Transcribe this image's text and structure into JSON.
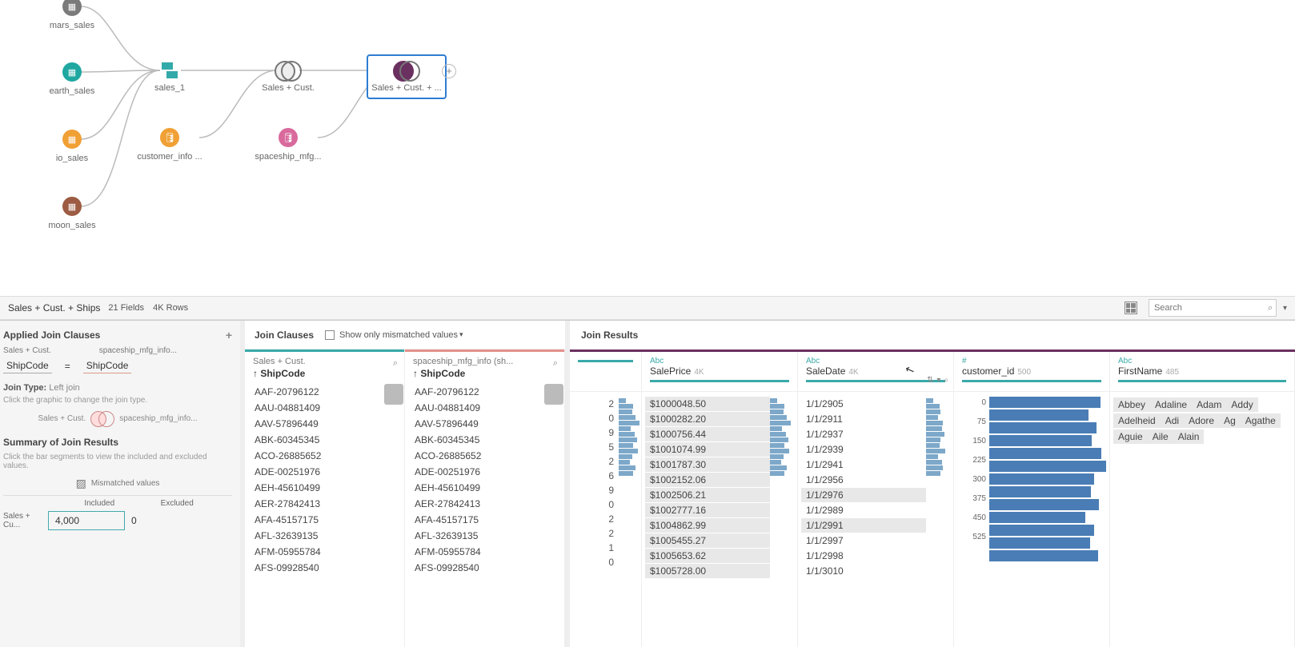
{
  "flow": {
    "nodes": {
      "mars_sales": {
        "label": "mars_sales",
        "color": "#7a7a7a"
      },
      "earth_sales": {
        "label": "earth_sales",
        "color": "#1fa7a0"
      },
      "io_sales": {
        "label": "io_sales",
        "color": "#f0a035"
      },
      "moon_sales": {
        "label": "moon_sales",
        "color": "#9c5b42"
      },
      "sales_1": {
        "label": "sales_1"
      },
      "customer_info": {
        "label": "customer_info ...",
        "color": "#f0a035"
      },
      "sales_cust": {
        "label": "Sales + Cust."
      },
      "spaceship_mfg": {
        "label": "spaceship_mfg...",
        "color": "#d96a9c"
      },
      "sales_cust_ships": {
        "label": "Sales + Cust. + ..."
      }
    }
  },
  "status": {
    "title": "Sales + Cust. + Ships",
    "fields": "21 Fields",
    "rows": "4K Rows",
    "search_placeholder": "Search"
  },
  "left": {
    "applied_title": "Applied Join Clauses",
    "src_left": "Sales + Cust.",
    "src_right": "spaceship_mfg_info...",
    "field_left": "ShipCode",
    "eq": "=",
    "field_right": "ShipCode",
    "join_type_label": "Join Type:",
    "join_type": "Left join",
    "hint1": "Click the graphic to change the join type.",
    "venn_left": "Sales + Cust.",
    "venn_right": "spaceship_mfg_info...",
    "summary_title": "Summary of Join Results",
    "hint2": "Click the bar segments to view the included and excluded values.",
    "mismatched": "Mismatched values",
    "col_included": "Included",
    "col_excluded": "Excluded",
    "row_label": "Sales + Cu...",
    "included_val": "4,000",
    "excluded_val": "0"
  },
  "jc": {
    "title": "Join Clauses",
    "filter": "Show only mismatched values",
    "left_src": "Sales + Cust.",
    "left_field": "↑ ShipCode",
    "right_src": "spaceship_mfg_info (sh...",
    "right_field": "↑ ShipCode",
    "codes": [
      "AAF-20796122",
      "AAU-04881409",
      "AAV-57896449",
      "ABK-60345345",
      "ACO-26885652",
      "ADE-00251976",
      "AEH-45610499",
      "AER-27842413",
      "AFA-45157175",
      "AFL-32639135",
      "AFM-05955784",
      "AFS-09928540"
    ]
  },
  "jr": {
    "title": "Join Results",
    "partial_digits": [
      "2",
      "0",
      "9",
      "5",
      "2",
      "6",
      "9",
      "0",
      "2",
      "2",
      "1",
      "0"
    ],
    "sale_price": {
      "type": "Abc",
      "name": "SalePrice",
      "count": "4K",
      "vals": [
        "$1000048.50",
        "$1000282.20",
        "$1000756.44",
        "$1001074.99",
        "$1001787.30",
        "$1002152.06",
        "$1002506.21",
        "$1002777.16",
        "$1004862.99",
        "$1005455.27",
        "$1005653.62",
        "$1005728.00"
      ],
      "hist": [
        30,
        60,
        55,
        70,
        85,
        50,
        65,
        75,
        60,
        80,
        55,
        45,
        70,
        60
      ]
    },
    "sale_date": {
      "type": "Abc",
      "name": "SaleDate",
      "count": "4K",
      "vals": [
        "1/1/2905",
        "1/1/2911",
        "1/1/2937",
        "1/1/2939",
        "1/1/2941",
        "1/1/2956",
        "1/1/2976",
        "1/1/2989",
        "1/1/2991",
        "1/1/2997",
        "1/1/2998",
        "1/1/3010"
      ],
      "hl": [
        6,
        8
      ],
      "hist": [
        30,
        55,
        60,
        50,
        70,
        65,
        75,
        60,
        55,
        80,
        50,
        65,
        70,
        60
      ]
    },
    "customer_id": {
      "type": "#",
      "name": "customer_id",
      "count": "500",
      "axis": [
        "0",
        "75",
        "150",
        "225",
        "300",
        "375",
        "450",
        "525"
      ],
      "bars": [
        95,
        85,
        92,
        88,
        96,
        100,
        90,
        87,
        94,
        82,
        90,
        86,
        93
      ]
    },
    "first_name": {
      "type": "Abc",
      "name": "FirstName",
      "count": "485",
      "vals": [
        "Abbey",
        "Adaline",
        "Adam",
        "Addy",
        "Adelheid",
        "Adi",
        "Adore",
        "Ag",
        "Agathe",
        "Aguie",
        "Aile",
        "Alain"
      ]
    }
  }
}
